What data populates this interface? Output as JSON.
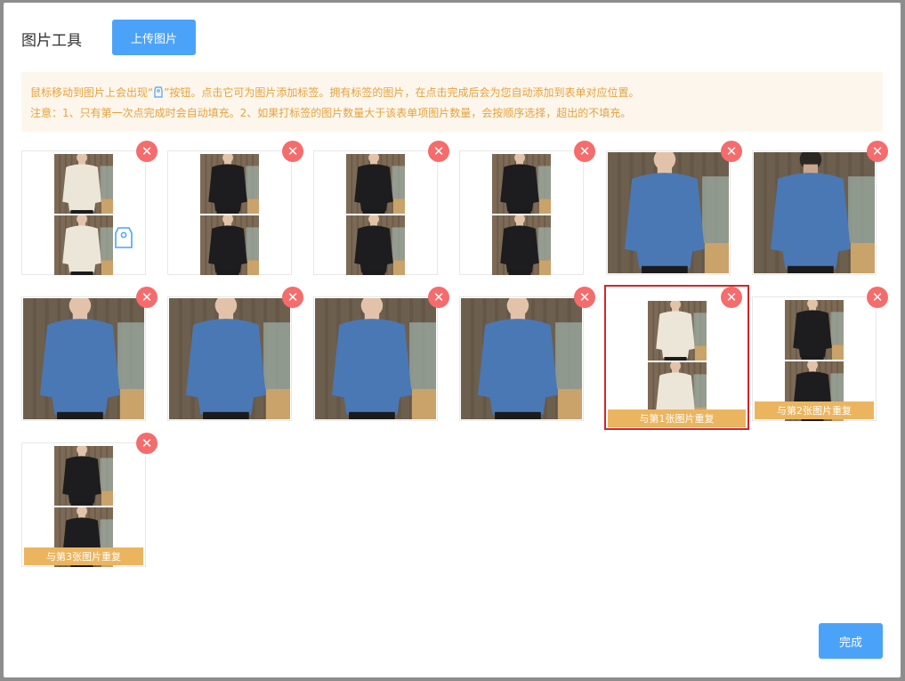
{
  "dialog": {
    "title": "图片工具",
    "upload_label": "上传图片",
    "done_label": "完成"
  },
  "notice": {
    "line1_before": "鼠标移动到图片上会出现“",
    "line1_after": "”按钮。点击它可为图片添加标签。拥有标签的图片，在点击完成后会为您自动添加到表单对应位置。",
    "line2": "注意：1、只有第一次点完成时会自动填充。2、如果打标签的图片数量大于该表单项图片数量，会按顺序选择，超出的不填充。",
    "icon": "tag-icon"
  },
  "colors": {
    "primary": "#4ba3f9",
    "danger": "#f56c6c",
    "warning_text": "#e6a23c",
    "warning_bg": "#fdf6ec",
    "dup_label_bg": "#ebb55f",
    "selected_border": "#d8232a"
  },
  "images": [
    {
      "layout": "stacked",
      "sweater": "cream",
      "tag_visible": true,
      "duplicate_label": ""
    },
    {
      "layout": "stacked",
      "sweater": "black",
      "duplicate_label": ""
    },
    {
      "layout": "stacked",
      "sweater": "black",
      "duplicate_label": ""
    },
    {
      "layout": "stacked",
      "sweater": "black",
      "duplicate_label": ""
    },
    {
      "layout": "full",
      "sweater": "blue",
      "duplicate_label": ""
    },
    {
      "layout": "full",
      "sweater": "blue",
      "view": "back",
      "duplicate_label": ""
    },
    {
      "layout": "full",
      "sweater": "blue",
      "duplicate_label": ""
    },
    {
      "layout": "full",
      "sweater": "blue",
      "duplicate_label": ""
    },
    {
      "layout": "full",
      "sweater": "blue",
      "duplicate_label": ""
    },
    {
      "layout": "full",
      "sweater": "blue",
      "duplicate_label": ""
    },
    {
      "layout": "stacked",
      "sweater": "cream",
      "selected": true,
      "duplicate_label": "与第1张图片重复"
    },
    {
      "layout": "stacked",
      "sweater": "black",
      "duplicate_label": "与第2张图片重复"
    },
    {
      "layout": "stacked",
      "sweater": "black",
      "duplicate_label": "与第3张图片重复"
    }
  ],
  "remove_icon": "close-icon"
}
